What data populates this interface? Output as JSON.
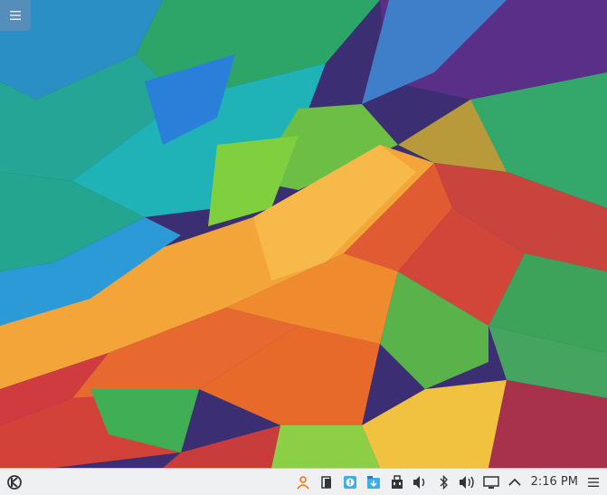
{
  "desktop": {
    "toolbox_icon": "hamburger-menu-icon"
  },
  "taskbar": {
    "launcher_icon": "kde-logo-icon",
    "tray": [
      {
        "name": "user-switcher-icon"
      },
      {
        "name": "clipboard-icon"
      },
      {
        "name": "notifications-icon"
      },
      {
        "name": "updates-icon"
      },
      {
        "name": "device-notifier-icon"
      },
      {
        "name": "volume-icon"
      },
      {
        "name": "bluetooth-icon"
      },
      {
        "name": "audio-volume-icon"
      },
      {
        "name": "network-icon"
      },
      {
        "name": "expand-tray-icon"
      }
    ],
    "clock": "2:16 PM",
    "panel_menu_icon": "panel-options-icon"
  },
  "colors": {
    "panel": "#eff0f1",
    "accent": "#3daee9",
    "user_icon": "#f67400"
  }
}
